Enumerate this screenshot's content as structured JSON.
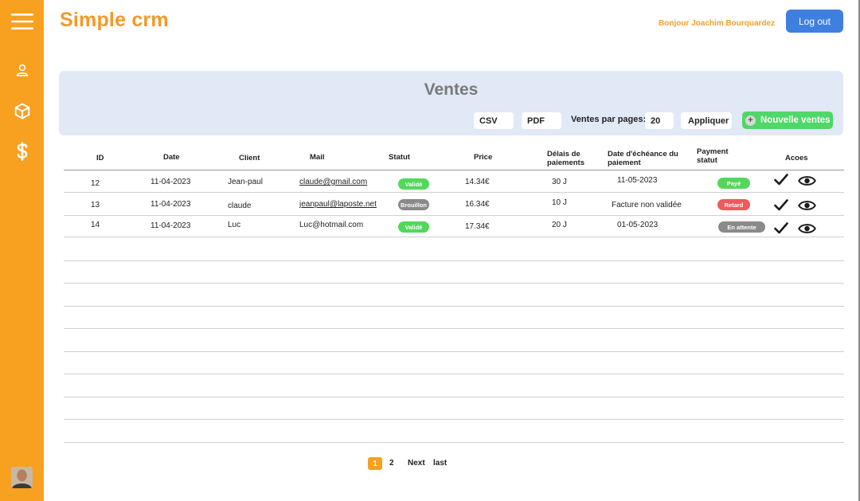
{
  "header": {
    "brand": "Simple crm",
    "greeting": "Bonjour Joachim Bourquardez",
    "logout_label": "Log out"
  },
  "sidebar": {
    "items": [
      {
        "icon": "menu-icon"
      },
      {
        "icon": "user-icon"
      },
      {
        "icon": "box-icon"
      },
      {
        "icon": "dollar-icon"
      }
    ],
    "avatar": "avatar"
  },
  "panel": {
    "title": "Ventes",
    "csv_label": "CSV",
    "pdf_label": "PDF",
    "per_page_label": "Ventes par pages:",
    "per_page_value": "20",
    "apply_label": "Appliquer",
    "new_sale_label": "Nouvelle ventes"
  },
  "table": {
    "headers": {
      "id": "ID",
      "date": "Date",
      "client": "Client",
      "mail": "Mail",
      "statut": "Statut",
      "price": "Price",
      "delais_1": "Délais de",
      "delais_2": "paiements",
      "echeance_1": "Date d'échéance du",
      "echeance_2": "paiement",
      "payment_1": "Payment",
      "payment_2": "statut",
      "actions": "Acoes"
    },
    "rows": [
      {
        "id": "12",
        "date": "11-04-2023",
        "client": "Jean-paul",
        "mail": "claude@gmail.com",
        "statut": "Validé",
        "price": "14.34€",
        "delais": "30 J",
        "echeance": "11-05-2023",
        "payment": "Payé"
      },
      {
        "id": "13",
        "date": "11-04-2023",
        "client": "claude",
        "mail": "jeanpaul@laposte.net",
        "statut": "Brouillon",
        "price": "16.34€",
        "delais": "10 J",
        "echeance": "Facture non validée",
        "payment": "Retard"
      },
      {
        "id": "14",
        "date": "11-04-2023",
        "client": "Luc",
        "mail": "Luc@hotmail.com",
        "statut": "Validé",
        "price": "17.34€",
        "delais": "20 J",
        "echeance": "01-05-2023",
        "payment": "En attente"
      }
    ]
  },
  "pagination": {
    "pages": [
      "1",
      "2"
    ],
    "next_label": "Next",
    "last_label": "last"
  },
  "colors": {
    "sidebar": "#f8a01f",
    "brand": "#f39a2a",
    "logout": "#3f7fe0",
    "panel": "#e1e8f6",
    "badge_valide": "#53d75b",
    "badge_brouillon": "#8a8a8a",
    "badge_paye": "#53d75b",
    "badge_retard": "#f05a5a",
    "badge_attente": "#8a8a8a",
    "new_sale": "#4fd768"
  }
}
